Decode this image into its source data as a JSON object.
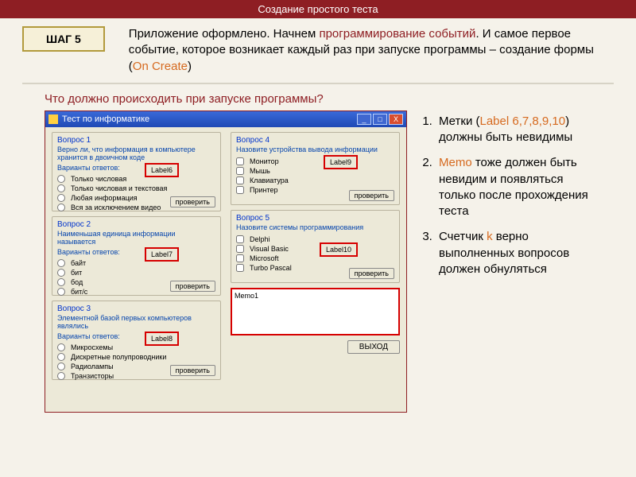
{
  "header": {
    "title": "Создание простого теста"
  },
  "step": {
    "label": "ШАГ 5"
  },
  "intro": {
    "p1a": "Приложение оформлено. Начнем ",
    "p1b": "программирование событий",
    "p1c": ". И самое первое событие, которое возникает каждый раз при запуске программы – создание формы (",
    "p1d": "On Create",
    "p1e": ")"
  },
  "subhead": "Что должно происходить при запуске программы?",
  "win": {
    "title": "Тест по информатике",
    "min": "_",
    "max": "□",
    "close": "X",
    "q1": {
      "title": "Вопрос 1",
      "text": "Верно ли, что информация в компьютере хранится в двоичном коде",
      "variants": "Варианты ответов:",
      "o1": "Только числовая",
      "o2": "Только числовая и текстовая",
      "o3": "Любая информация",
      "o4": "Вся за исключением видео",
      "label": "Label6",
      "btn": "проверить"
    },
    "q2": {
      "title": "Вопрос 2",
      "text": "Наименьшая единица информации называется",
      "variants": "Варианты ответов:",
      "o1": "байт",
      "o2": "бит",
      "o3": "бод",
      "o4": "бит/с",
      "label": "Label7",
      "btn": "проверить"
    },
    "q3": {
      "title": "Вопрос 3",
      "text": "Элементной базой первых компьютеров являлись",
      "variants": "Варианты ответов:",
      "o1": "Микросхемы",
      "o2": "Дискретные полупроводники",
      "o3": "Радиолампы",
      "o4": "Транзисторы",
      "label": "Label8",
      "btn": "проверить"
    },
    "q4": {
      "title": "Вопрос 4",
      "text": "Назовите устройства вывода информации",
      "o1": "Монитор",
      "o2": "Мышь",
      "o3": "Клавиатура",
      "o4": "Принтер",
      "label": "Label9",
      "btn": "проверить"
    },
    "q5": {
      "title": "Вопрос 5",
      "text": "Назовите системы программирования",
      "o1": "Delphi",
      "o2": "Visual Basic",
      "o3": "Microsoft",
      "o4": "Turbo Pascal",
      "label": "Label10",
      "btn": "проверить"
    },
    "memo": "Memo1",
    "exit": "ВЫХОД"
  },
  "points": {
    "p1a": "Метки (",
    "p1b": "Label 6,7,8,9,10",
    "p1c": ") должны быть невидимы",
    "p2a": "Memo",
    "p2b": " тоже должен быть невидим и появляться только после прохождения теста",
    "p3a": "Счетчик ",
    "p3b": "k",
    "p3c": " верно выполненных вопросов должен обнуляться"
  }
}
